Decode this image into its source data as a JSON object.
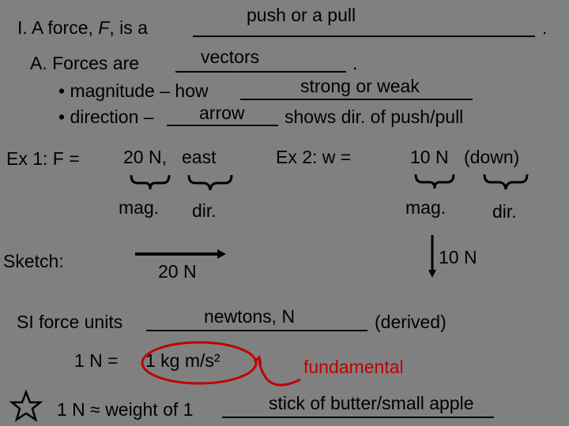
{
  "heading": {
    "prefix": "I.  A force, ",
    "var": "F",
    "suffix": ", is a",
    "answer": "push or a pull",
    "end": "."
  },
  "subA": {
    "prefix": "A.  Forces are",
    "answer": "vectors",
    "end": "."
  },
  "bullet1": {
    "prefix": "• magnitude – how",
    "answer": "strong or weak"
  },
  "bullet2": {
    "prefix": "• direction –",
    "answer": "arrow",
    "suffix": "shows dir. of push/pull"
  },
  "ex1": {
    "label": "Ex 1:  F =",
    "magnitude": "20 N,",
    "direction": "east",
    "mag_label": "mag.",
    "dir_label": "dir.",
    "sketch_label": "Sketch:",
    "arrow_label": "20 N"
  },
  "ex2": {
    "label": "Ex 2:   w =",
    "magnitude": "10 N",
    "direction": "(down)",
    "mag_label": "mag.",
    "dir_label": "dir.",
    "arrow_label": "10 N"
  },
  "units": {
    "prefix": "SI force units",
    "answer": "newtons, N",
    "suffix": "(derived)",
    "eq_prefix": "1 N =",
    "eq_value": "1 kg m/s²",
    "annotation": "fundamental",
    "annotation_color": "#c00000"
  },
  "approx": {
    "prefix": "1 N ≈ weight of 1",
    "answer": "stick of butter/small apple"
  }
}
